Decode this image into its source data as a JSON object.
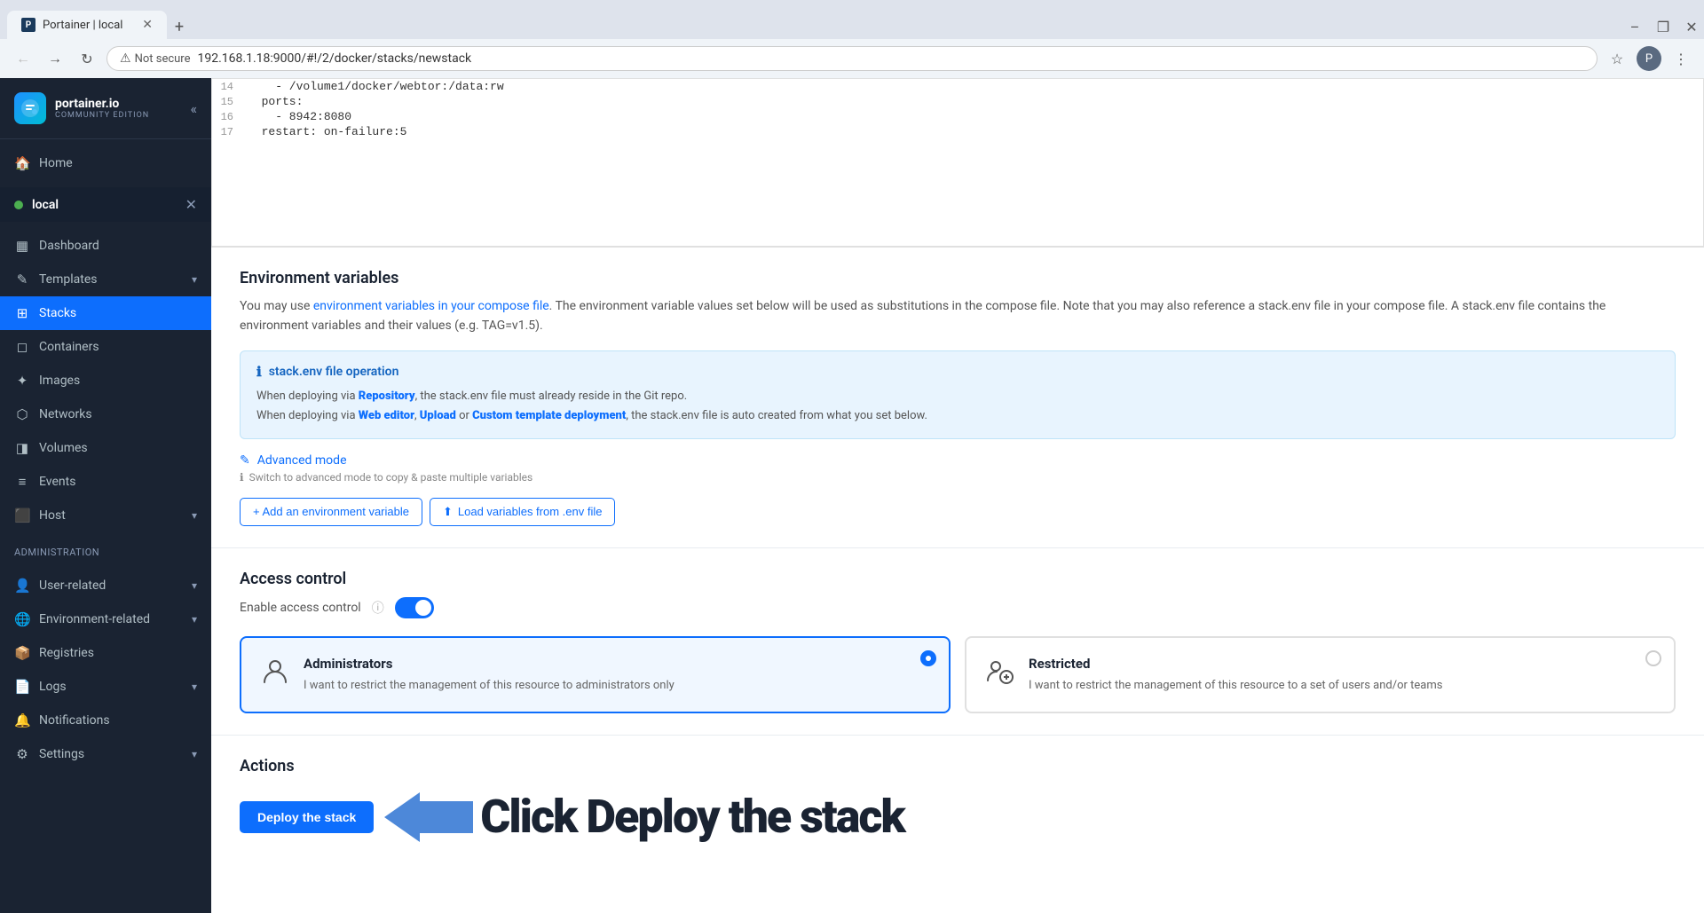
{
  "browser": {
    "tab_title": "Portainer | local",
    "favicon_label": "P",
    "address_bar": {
      "not_secure_text": "Not secure",
      "url": "192.168.1.18:9000/#!/2/docker/stacks/newstack"
    },
    "window_controls": {
      "minimize": "–",
      "maximize": "❐",
      "close": "✕"
    }
  },
  "sidebar": {
    "logo_main": "portainer.io",
    "logo_sub": "Community Edition",
    "collapse_icon": "«",
    "environment": {
      "name": "local",
      "status": "connected"
    },
    "nav_items": [
      {
        "id": "home",
        "label": "Home",
        "icon": "🏠"
      },
      {
        "id": "dashboard",
        "label": "Dashboard",
        "icon": "▦"
      },
      {
        "id": "templates",
        "label": "Templates",
        "icon": "✎",
        "has_chevron": true
      },
      {
        "id": "stacks",
        "label": "Stacks",
        "icon": "⊞",
        "active": true
      },
      {
        "id": "containers",
        "label": "Containers",
        "icon": "◻"
      },
      {
        "id": "images",
        "label": "Images",
        "icon": "✦"
      },
      {
        "id": "networks",
        "label": "Networks",
        "icon": "⬡"
      },
      {
        "id": "volumes",
        "label": "Volumes",
        "icon": "◨"
      },
      {
        "id": "events",
        "label": "Events",
        "icon": "≡"
      },
      {
        "id": "host",
        "label": "Host",
        "icon": "⬛",
        "has_chevron": true
      }
    ],
    "admin_label": "Administration",
    "admin_items": [
      {
        "id": "user-related",
        "label": "User-related",
        "icon": "👤",
        "has_chevron": true
      },
      {
        "id": "environment-related",
        "label": "Environment-related",
        "icon": "🌐",
        "has_chevron": true
      },
      {
        "id": "registries",
        "label": "Registries",
        "icon": "📦"
      },
      {
        "id": "logs",
        "label": "Logs",
        "icon": "📄",
        "has_chevron": true
      },
      {
        "id": "notifications",
        "label": "Notifications",
        "icon": "🔔"
      },
      {
        "id": "settings",
        "label": "Settings",
        "icon": "⚙",
        "has_chevron": true
      }
    ]
  },
  "code": {
    "lines": [
      {
        "num": "14",
        "code": "    - /volume1/docker/webtor:/data:rw"
      },
      {
        "num": "15",
        "code": "  ports:"
      },
      {
        "num": "16",
        "code": "    - 8942:8080"
      },
      {
        "num": "17",
        "code": "  restart: on-failure:5"
      }
    ]
  },
  "env_section": {
    "title": "Environment variables",
    "description": "You may use environment variables in your compose file. The environment variable values set below will be used as substitutions in the compose file. Note that you may also reference a stack.env file in your compose file. A stack.env file contains the environment variables and their values (e.g. TAG=v1.5).",
    "env_link_text": "environment variables in your compose file",
    "info_box": {
      "title": "stack.env file operation",
      "line1_prefix": "When deploying via ",
      "line1_link": "Repository",
      "line1_suffix": ", the stack.env file must already reside in the Git repo.",
      "line2_prefix": "When deploying via ",
      "line2_link1": "Web editor",
      "line2_sep1": ", ",
      "line2_link2": "Upload",
      "line2_sep2": " or ",
      "line2_link3": "Custom template deployment",
      "line2_suffix": ", the stack.env file is auto created from what you set below."
    },
    "advanced_mode_label": "Advanced mode",
    "advanced_hint": "Switch to advanced mode to copy & paste multiple variables",
    "btn_add": "+ Add an environment variable",
    "btn_load": "Load variables from .env file"
  },
  "access_section": {
    "title": "Access control",
    "toggle_label": "Enable access control",
    "toggle_on": true,
    "cards": [
      {
        "id": "administrators",
        "title": "Administrators",
        "description": "I want to restrict the management of this resource to administrators only",
        "selected": true
      },
      {
        "id": "restricted",
        "title": "Restricted",
        "description": "I want to restrict the management of this resource to a set of users and/or teams",
        "selected": false
      }
    ]
  },
  "actions_section": {
    "title": "Actions",
    "deploy_button_label": "Deploy the stack",
    "annotation_text": "Click Deploy the stack"
  }
}
